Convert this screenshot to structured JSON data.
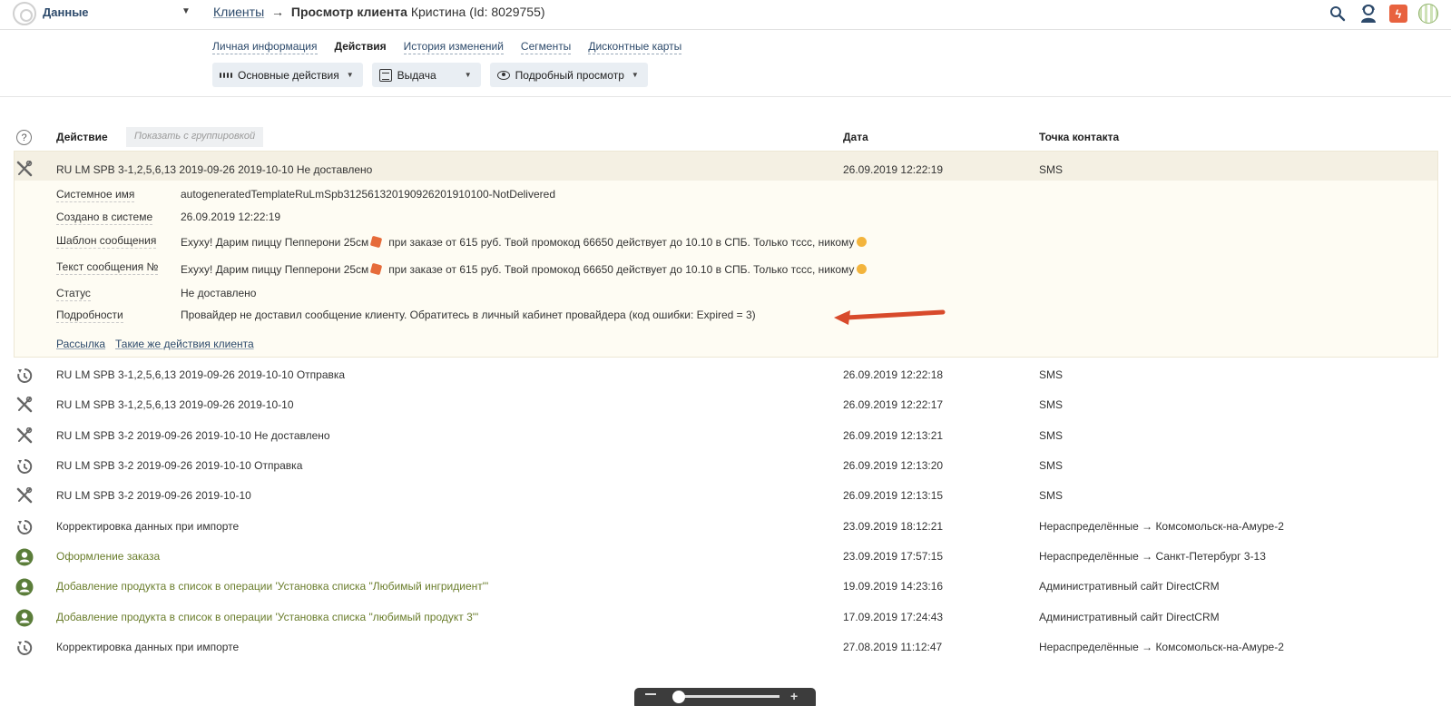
{
  "header": {
    "app_name": "Данные",
    "breadcrumb_link": "Клиенты",
    "breadcrumb_arrow": "→",
    "page_title": "Просмотр клиента",
    "client_label": "Кристина (Id: 8029755)",
    "bolt_glyph": "ϟ"
  },
  "tabs": [
    {
      "label": "Личная информация",
      "active": false
    },
    {
      "label": "Действия",
      "active": true
    },
    {
      "label": "История изменений",
      "active": false
    },
    {
      "label": "Сегменты",
      "active": false
    },
    {
      "label": "Дисконтные карты",
      "active": false
    }
  ],
  "toolbar": {
    "main_actions": "Основные действия",
    "issue": "Выдача",
    "detailed_view": "Подробный просмотр"
  },
  "table": {
    "help": "?",
    "col_action": "Действие",
    "group_toggle": "Показать с группировкой",
    "col_date": "Дата",
    "col_contact": "Точка контакта"
  },
  "selected_row": {
    "icon": "failed-icon",
    "text": "RU LM SPB 3-1,2,5,6,13 2019-09-26 2019-10-10 Не доставлено",
    "date": "26.09.2019 12:22:19",
    "contact": "SMS"
  },
  "details": {
    "system_name_label": "Системное имя",
    "system_name_value": "autogeneratedTemplateRuLmSpb312561320190926201910100-NotDelivered",
    "created_label": "Создано в системе",
    "created_value": "26.09.2019 12:22:19",
    "template_label": "Шаблон сообщения",
    "template_value_a": "Ехуху! Дарим пиццу Пепперони 25см",
    "template_value_b": "при заказе от 615 руб. Твой промокод 66650 действует до 10.10 в СПБ. Только тссс, никому",
    "message_label": "Текст сообщения №",
    "message_value_a": "Ехуху! Дарим пиццу Пепперони 25см",
    "message_value_b": "при заказе от 615 руб. Твой промокод 66650 действует до 10.10 в СПБ. Только тссс, никому",
    "status_label": "Статус",
    "status_value": "Не доставлено",
    "details_label": "Подробности",
    "details_value": "Провайдер не доставил сообщение клиенту. Обратитесь в личный кабинет провайдера (код ошибки: Expired = 3)",
    "link_mailing": "Рассылка",
    "link_same_actions": "Такие же действия клиента"
  },
  "rows": [
    {
      "icon": "send-icon",
      "text": "RU LM SPB 3-1,2,5,6,13 2019-09-26 2019-10-10 Отправка",
      "date": "26.09.2019 12:22:18",
      "contact": "SMS",
      "green": false
    },
    {
      "icon": "failed-icon",
      "text": "RU LM SPB 3-1,2,5,6,13 2019-09-26 2019-10-10",
      "date": "26.09.2019 12:22:17",
      "contact": "SMS",
      "green": false
    },
    {
      "icon": "failed-icon",
      "text": "RU LM SPB 3-2 2019-09-26 2019-10-10 Не доставлено",
      "date": "26.09.2019 12:13:21",
      "contact": "SMS",
      "green": false
    },
    {
      "icon": "send-icon",
      "text": "RU LM SPB 3-2 2019-09-26 2019-10-10 Отправка",
      "date": "26.09.2019 12:13:20",
      "contact": "SMS",
      "green": false
    },
    {
      "icon": "failed-icon",
      "text": "RU LM SPB 3-2 2019-09-26 2019-10-10",
      "date": "26.09.2019 12:13:15",
      "contact": "SMS",
      "green": false
    },
    {
      "icon": "send-icon",
      "text": "Корректировка данных при импорте",
      "date": "23.09.2019 18:12:21",
      "contact": "Нераспределённые → Комсомольск-на-Амуре-2",
      "green": false
    },
    {
      "icon": "user-icon",
      "text": "Оформление заказа",
      "date": "23.09.2019 17:57:15",
      "contact": "Нераспределённые → Санкт-Петербург 3-13",
      "green": true
    },
    {
      "icon": "user-icon",
      "text": "Добавление продукта в список в операции 'Установка списка \"Любимый ингридиент\"'",
      "date": "19.09.2019 14:23:16",
      "contact": "Административный сайт DirectCRM",
      "green": true
    },
    {
      "icon": "user-icon",
      "text": "Добавление продукта в список в операции 'Установка списка \"любимый продукт 3\"'",
      "date": "17.09.2019 17:24:43",
      "contact": "Административный сайт DirectCRM",
      "green": true
    },
    {
      "icon": "send-icon",
      "text": "Корректировка данных при импорте",
      "date": "27.08.2019 11:12:47",
      "contact": "Нераспределённые → Комсомольск-на-Амуре-2",
      "green": false
    }
  ],
  "colors": {
    "link": "#2d4a6b",
    "green_text": "#6a7d2c",
    "user_icon": "#5b7d3a",
    "selected_bg": "#fefcf3",
    "arrow": "#d84a2b"
  }
}
